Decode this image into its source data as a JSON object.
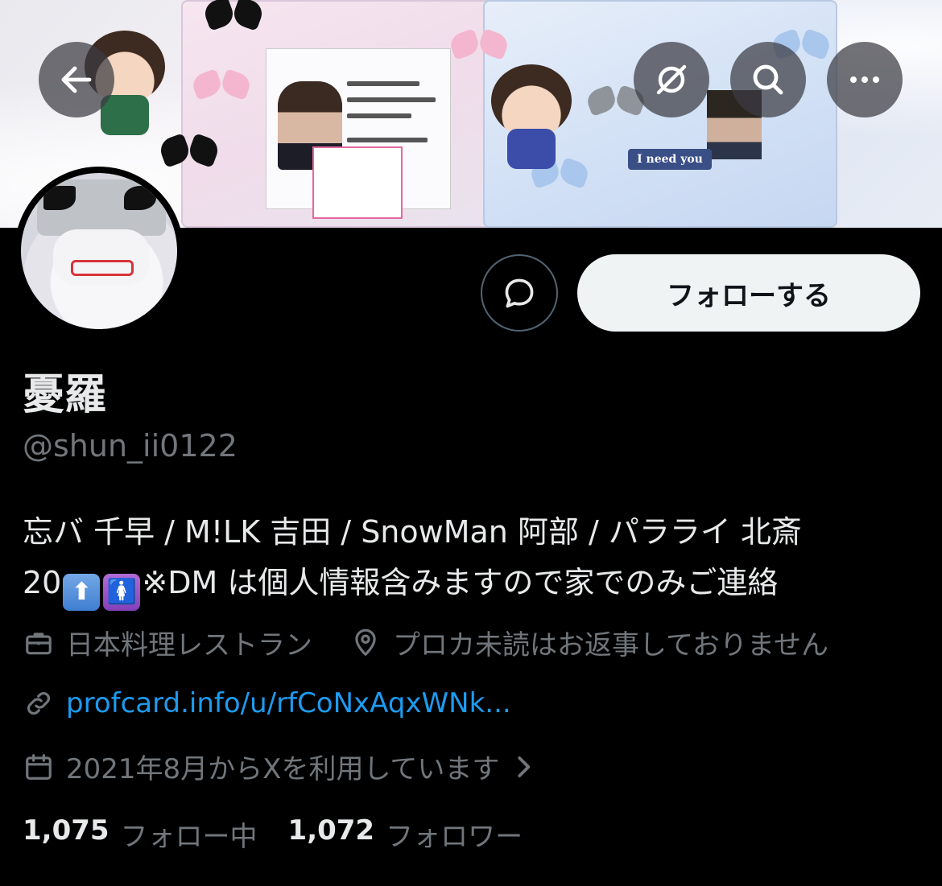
{
  "profile": {
    "name": "憂羅",
    "handle": "@shun_ii0122",
    "bio_line1": "忘バ 千早 / M!LK 吉田 / SnowMan 阿部 / パラライ 北斎",
    "bio_line2_prefix": "20",
    "bio_line2_suffix": "※DM は個人情報含みますので家でのみご連絡",
    "emoji_1": "⬆",
    "emoji_2": "🚺",
    "category": "日本料理レストラン",
    "location": "プロカ未読はお返事しておりません",
    "link": "profcard.info/u/rfCoNxAqxWNk...",
    "joined": "2021年8月からXを利用しています"
  },
  "stats": {
    "following_count": "1,075",
    "following_label": "フォロー中",
    "followers_count": "1,072",
    "followers_label": "フォロワー"
  },
  "actions": {
    "follow_label": "フォローする"
  },
  "banner": {
    "tag_text": "I need you"
  },
  "colors": {
    "background": "#000000",
    "primary_text": "#e7e9ea",
    "secondary_text": "#71767b",
    "link": "#1d9bf0",
    "follow_button_bg": "#eff3f4"
  },
  "icons": {
    "back": "arrow-left-icon",
    "grok": "grok-icon",
    "search": "search-icon",
    "more": "more-icon",
    "message": "message-icon",
    "category": "briefcase-icon",
    "location": "location-pin-icon",
    "link": "link-icon",
    "joined": "calendar-icon",
    "chevron": "chevron-right-icon"
  }
}
